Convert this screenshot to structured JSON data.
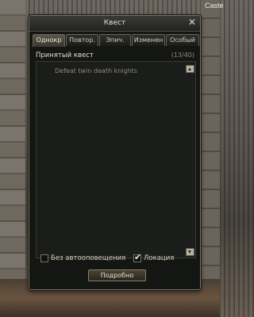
{
  "background": {
    "corner_text": "Caste"
  },
  "window": {
    "title": "Квест",
    "tabs": [
      {
        "label": "Однокр",
        "active": true
      },
      {
        "label": "Повтор.",
        "active": false
      },
      {
        "label": "Эпич.",
        "active": false
      },
      {
        "label": "Изменен",
        "active": false
      },
      {
        "label": "Особый",
        "active": false
      }
    ],
    "accepted_label": "Принятый квест",
    "accepted_count": "(13/40)",
    "quests": [
      "Defeat twin death knights"
    ],
    "options": [
      {
        "label": "Без автооповещения",
        "checked": false
      },
      {
        "label": "Локация",
        "checked": true
      }
    ],
    "detail_button": "Подробно"
  }
}
